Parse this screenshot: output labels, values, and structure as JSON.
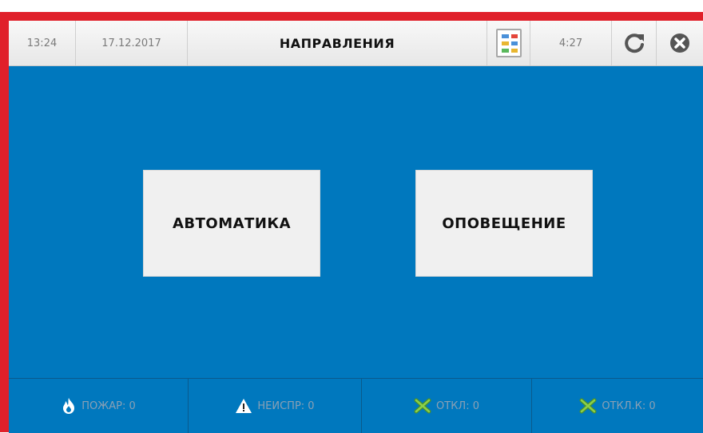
{
  "header": {
    "time": "13:24",
    "date": "17.12.2017",
    "title": "НАПРАВЛЕНИЯ",
    "timer": "4:27",
    "report_icon": "report-document-icon",
    "refresh_icon": "refresh-icon",
    "close_icon": "close-circle-icon"
  },
  "main": {
    "buttons": [
      {
        "label": "АВТОМАТИКА"
      },
      {
        "label": "ОПОВЕЩЕНИЕ"
      }
    ]
  },
  "status": [
    {
      "label": "ПОЖАР: 0",
      "icon": "fire-icon"
    },
    {
      "label": "НЕИСПР: 0",
      "icon": "warning-icon"
    },
    {
      "label": "ОТКЛ: 0",
      "icon": "disabled-x-icon"
    },
    {
      "label": "ОТКЛ.К: 0",
      "icon": "disabled-x-icon"
    }
  ],
  "colors": {
    "background": "#0078be",
    "border": "#e0202a",
    "button": "#f0f0f0"
  }
}
